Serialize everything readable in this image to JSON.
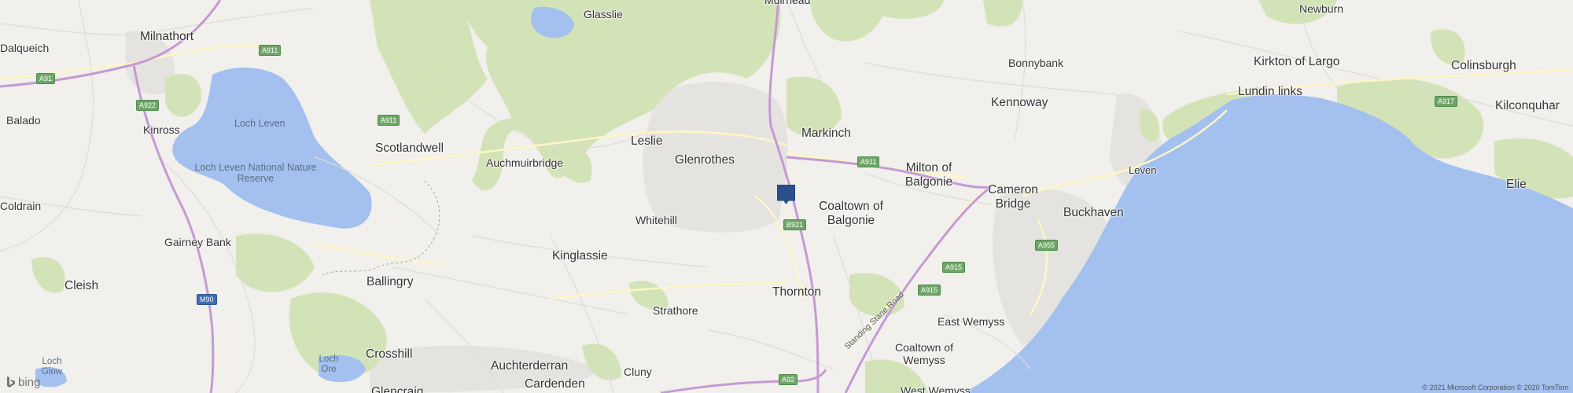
{
  "map": {
    "labels": {
      "dalqueich": "Dalqueich",
      "milnathort": "Milnathort",
      "glasslie": "Glasslie",
      "muirhead": "Muirhead",
      "newburn": "Newburn",
      "balado": "Balado",
      "kinross": "Kinross",
      "loch_leven": "Loch Leven",
      "loch_leven_nnr": "Loch Leven National Nature Reserve",
      "scotlandwell": "Scotlandwell",
      "auchmuirbridge": "Auchmuirbridge",
      "leslie": "Leslie",
      "glenrothes": "Glenrothes",
      "markinch": "Markinch",
      "bonnybank": "Bonnybank",
      "kennoway": "Kennoway",
      "kirkton_of_largo": "Kirkton of Largo",
      "colinsburgh": "Colinsburgh",
      "lundin_links": "Lundin links",
      "kilconquhar": "Kilconquhar",
      "coldrain": "Coldrain",
      "milton_of_balgonie": "Milton of Balgonie",
      "cameron_bridge": "Cameron Bridge",
      "leven": "Leven",
      "elie": "Elie",
      "whitehill": "Whitehill",
      "coaltown_of_balgonie": "Coaltown of Balgonie",
      "buckhaven": "Buckhaven",
      "gairney_bank": "Gairney Bank",
      "kinglassie": "Kinglassie",
      "cleish": "Cleish",
      "ballingry": "Ballingry",
      "thornton": "Thornton",
      "strathore": "Strathore",
      "east_wemyss": "East Wemyss",
      "crosshill": "Crosshill",
      "auchterderran": "Auchterderran",
      "coaltown_of_wemyss": "Coaltown of Wemyss",
      "loch_glow": "Loch Glow",
      "loch_ore": "Loch Ore",
      "cluny": "Cluny",
      "cardenden": "Cardenden",
      "glencraig": "Glencraig",
      "west_wemyss": "West Wemyss"
    },
    "roads": {
      "a91_w": "A91",
      "a911_n": "A911",
      "a922": "A922",
      "a911_s": "A911",
      "a911_e": "A911",
      "b921": "B921",
      "a915_1": "A915",
      "a915_2": "A915",
      "a955": "A955",
      "a917": "A917",
      "m90": "M90",
      "a92": "A92",
      "standing_stane": "Standing Stane Road"
    },
    "attribution": {
      "logo": "bing",
      "copyright": "© 2021 Microsoft Corporation © 2020 TomTom"
    },
    "colors": {
      "land": "#f1f0ec",
      "water": "#a3c0ef",
      "forest": "#cfe0b3",
      "motorway": "#c59ad4",
      "marker": "#2b4f8a"
    }
  }
}
